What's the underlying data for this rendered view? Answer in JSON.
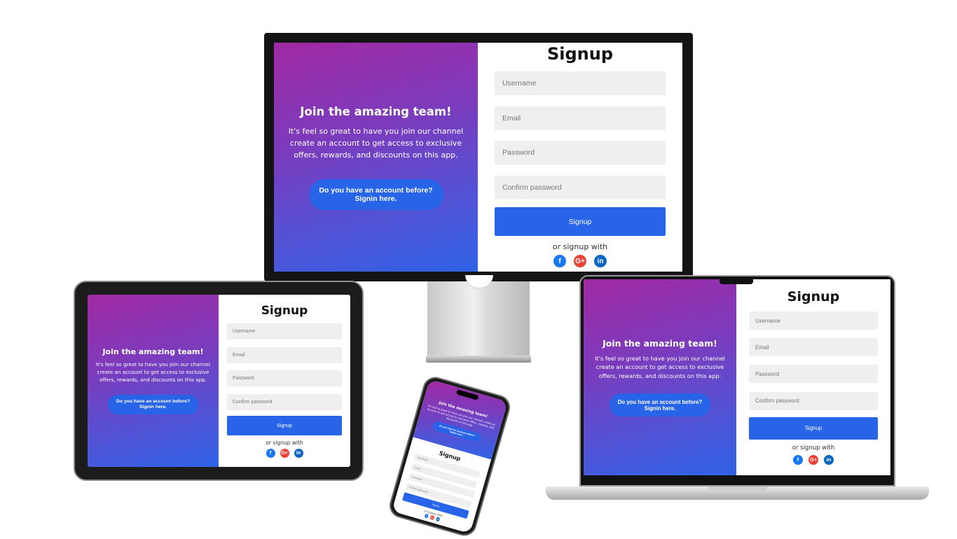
{
  "promo": {
    "heading": "Join the amazing team!",
    "text": "It's feel so great to have you join our channel create an account to get access to exclusive offers, rewards, and discounts on this app.",
    "cta_line1": "Do you have an account before?",
    "cta_line2": "Signin here."
  },
  "form": {
    "title": "Signup",
    "username_placeholder": "Username",
    "email_placeholder": "Email",
    "password_placeholder": "Password",
    "confirm_placeholder": "Confirm password",
    "submit_label": "Signup",
    "alt_text": "or signup with"
  },
  "social": {
    "facebook": {
      "glyph": "f",
      "icon": "facebook-icon",
      "color": "#1877f2"
    },
    "google": {
      "glyph": "G+",
      "icon": "google-plus-icon",
      "color": "#ea4335"
    },
    "linkedin": {
      "glyph": "in",
      "icon": "linkedin-icon",
      "color": "#0a66c2"
    }
  },
  "colors": {
    "gradient_start": "#a229a3",
    "gradient_end": "#2f63e6",
    "accent": "#2764e8",
    "field_bg": "#efefef"
  },
  "devices": [
    "monitor",
    "tablet",
    "laptop",
    "phone"
  ]
}
